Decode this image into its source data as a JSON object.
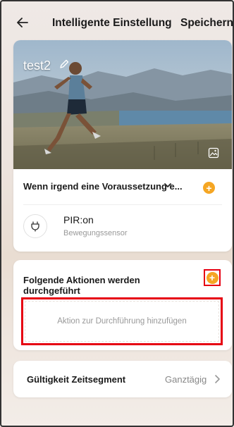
{
  "header": {
    "title": "Intelligente Einstellung",
    "save_label": "Speichern"
  },
  "scene": {
    "name": "test2",
    "condition_label": "Wenn irgend eine Voraussetzung e...",
    "device": {
      "name": "PIR:on",
      "type": "Bewegungssensor"
    }
  },
  "actions": {
    "title": "Folgende Aktionen werden durchgeführt",
    "add_placeholder": "Aktion zur Durchführung hinzufügen"
  },
  "validity": {
    "label": "Gültigkeit Zeitsegment",
    "value": "Ganztägig"
  },
  "icons": {
    "back": "arrow-left-icon",
    "edit": "pencil-icon",
    "image": "image-icon",
    "dropdown": "chevron-down-icon",
    "add": "plus-circle-icon",
    "device": "plug-icon",
    "next": "chevron-right-icon"
  },
  "colors": {
    "accent": "#f5a623",
    "highlight": "#e60012"
  }
}
